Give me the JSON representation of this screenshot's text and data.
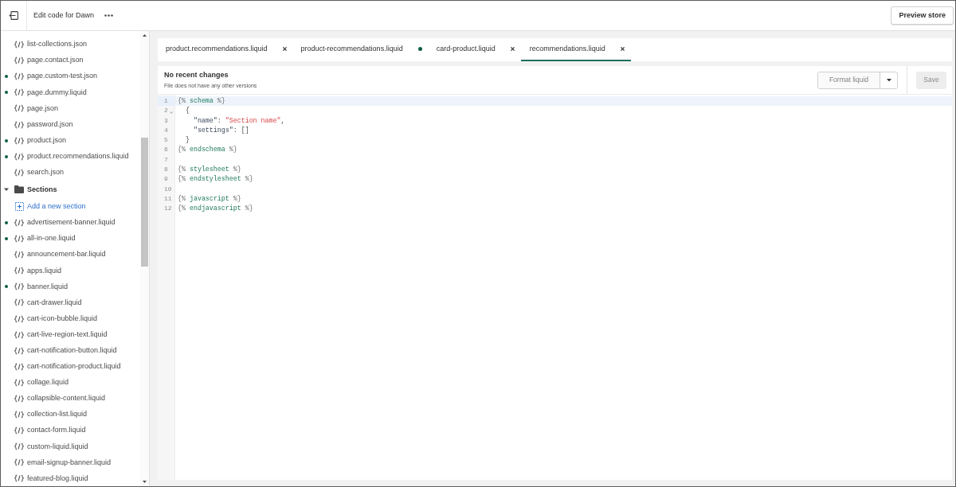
{
  "top_bar": {
    "title": "Edit code for Dawn",
    "preview_button": "Preview store"
  },
  "sidebar": {
    "items": [
      {
        "kind": "file",
        "name": "list-collections.json",
        "modified": false
      },
      {
        "kind": "file",
        "name": "page.contact.json",
        "modified": false
      },
      {
        "kind": "file",
        "name": "page.custom-test.json",
        "modified": true
      },
      {
        "kind": "file",
        "name": "page.dummy.liquid",
        "modified": true
      },
      {
        "kind": "file",
        "name": "page.json",
        "modified": false
      },
      {
        "kind": "file",
        "name": "password.json",
        "modified": false
      },
      {
        "kind": "file",
        "name": "product.json",
        "modified": true
      },
      {
        "kind": "file",
        "name": "product.recommendations.liquid",
        "modified": true
      },
      {
        "kind": "file",
        "name": "search.json",
        "modified": false
      },
      {
        "kind": "folder",
        "name": "Sections",
        "expanded": true,
        "children": [
          {
            "kind": "add",
            "name": "Add a new section"
          },
          {
            "kind": "file",
            "name": "advertisement-banner.liquid",
            "modified": true
          },
          {
            "kind": "file",
            "name": "all-in-one.liquid",
            "modified": true
          },
          {
            "kind": "file",
            "name": "announcement-bar.liquid",
            "modified": false
          },
          {
            "kind": "file",
            "name": "apps.liquid",
            "modified": false
          },
          {
            "kind": "file",
            "name": "banner.liquid",
            "modified": true
          },
          {
            "kind": "file",
            "name": "cart-drawer.liquid",
            "modified": false
          },
          {
            "kind": "file",
            "name": "cart-icon-bubble.liquid",
            "modified": false
          },
          {
            "kind": "file",
            "name": "cart-live-region-text.liquid",
            "modified": false
          },
          {
            "kind": "file",
            "name": "cart-notification-button.liquid",
            "modified": false
          },
          {
            "kind": "file",
            "name": "cart-notification-product.liquid",
            "modified": false
          },
          {
            "kind": "file",
            "name": "collage.liquid",
            "modified": false
          },
          {
            "kind": "file",
            "name": "collapsible-content.liquid",
            "modified": false
          },
          {
            "kind": "file",
            "name": "collection-list.liquid",
            "modified": false
          },
          {
            "kind": "file",
            "name": "contact-form.liquid",
            "modified": false
          },
          {
            "kind": "file",
            "name": "custom-liquid.liquid",
            "modified": false
          },
          {
            "kind": "file",
            "name": "email-signup-banner.liquid",
            "modified": false
          },
          {
            "kind": "file",
            "name": "featured-blog.liquid",
            "modified": false
          }
        ]
      }
    ]
  },
  "tabs": [
    {
      "label": "product.recommendations.liquid",
      "selected": false,
      "unsaved": false
    },
    {
      "label": "product-recommendations.liquid",
      "selected": false,
      "unsaved": true
    },
    {
      "label": "card-product.liquid",
      "selected": false,
      "unsaved": false
    },
    {
      "label": "recommendations.liquid",
      "selected": true,
      "unsaved": false
    }
  ],
  "editor": {
    "status_title": "No recent changes",
    "status_subtitle": "File does not have any other versions",
    "format_button": {
      "label": "Format liquid",
      "disabled": true
    },
    "save_button": {
      "label": "Save",
      "disabled": true
    },
    "lines": [
      {
        "number": "1",
        "current": true,
        "foldable": false,
        "tokens": [
          {
            "kind": "tag",
            "text": "{%"
          },
          {
            "kind": "keyword",
            "text": " schema "
          },
          {
            "kind": "tag",
            "text": "%}"
          }
        ]
      },
      {
        "number": "2",
        "current": false,
        "foldable": true,
        "tokens": [
          {
            "kind": "plain",
            "text": "  {"
          }
        ]
      },
      {
        "number": "3",
        "current": false,
        "foldable": false,
        "tokens": [
          {
            "kind": "key",
            "text": "    \"name\""
          },
          {
            "kind": "plain",
            "text": ": "
          },
          {
            "kind": "string",
            "text": "\"Section name\""
          },
          {
            "kind": "plain",
            "text": ","
          }
        ]
      },
      {
        "number": "4",
        "current": false,
        "foldable": false,
        "tokens": [
          {
            "kind": "key",
            "text": "    \"settings\""
          },
          {
            "kind": "plain",
            "text": ": []"
          }
        ]
      },
      {
        "number": "5",
        "current": false,
        "foldable": false,
        "tokens": [
          {
            "kind": "plain",
            "text": "  }"
          }
        ]
      },
      {
        "number": "6",
        "current": false,
        "foldable": false,
        "tokens": [
          {
            "kind": "tag",
            "text": "{%"
          },
          {
            "kind": "keyword",
            "text": " endschema "
          },
          {
            "kind": "tag",
            "text": "%}"
          }
        ]
      },
      {
        "number": "7",
        "current": false,
        "foldable": false
      },
      {
        "number": "8",
        "current": false,
        "foldable": false,
        "tokens": [
          {
            "kind": "tag",
            "text": "{%"
          },
          {
            "kind": "keyword",
            "text": " stylesheet "
          },
          {
            "kind": "tag",
            "text": "%}"
          }
        ]
      },
      {
        "number": "9",
        "current": false,
        "foldable": false,
        "tokens": [
          {
            "kind": "tag",
            "text": "{%"
          },
          {
            "kind": "keyword",
            "text": " endstylesheet "
          },
          {
            "kind": "tag",
            "text": "%}"
          }
        ]
      },
      {
        "number": "10",
        "current": false,
        "foldable": false
      },
      {
        "number": "11",
        "current": false,
        "foldable": false,
        "tokens": [
          {
            "kind": "tag",
            "text": "{%"
          },
          {
            "kind": "keyword",
            "text": " javascript "
          },
          {
            "kind": "tag",
            "text": "%}"
          }
        ]
      },
      {
        "number": "12",
        "current": false,
        "foldable": false,
        "tokens": [
          {
            "kind": "tag",
            "text": "{%"
          },
          {
            "kind": "keyword",
            "text": " endjavascript "
          },
          {
            "kind": "tag",
            "text": "%}"
          }
        ]
      }
    ]
  }
}
